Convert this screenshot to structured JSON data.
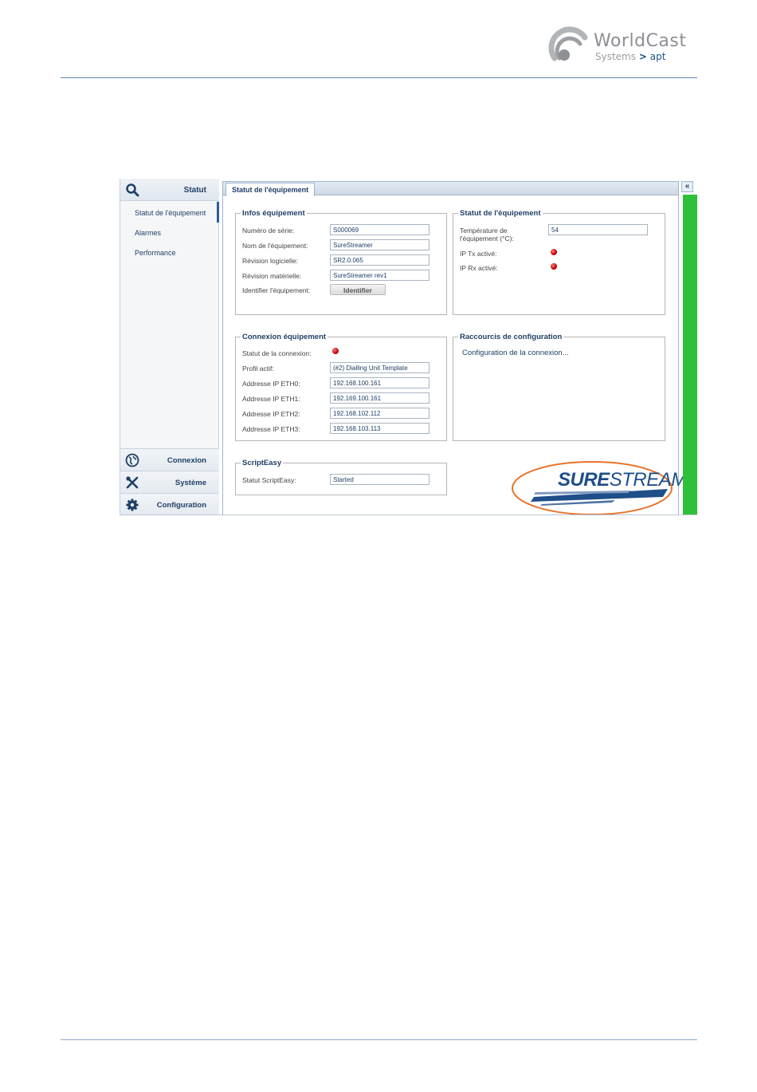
{
  "header": {
    "brand_name": "WorldCast",
    "brand_sub": "Systems",
    "brand_arrow": ">",
    "brand_apt": "apt"
  },
  "sidebar": {
    "top_title": "Statut",
    "items": [
      {
        "label": "Statut de l'équipement",
        "active": true
      },
      {
        "label": "Alarmes"
      },
      {
        "label": "Performance"
      }
    ],
    "bottom": [
      {
        "label": "Connexion",
        "icon": "globe-icon"
      },
      {
        "label": "Système",
        "icon": "tools-icon"
      },
      {
        "label": "Configuration",
        "icon": "gear-icon"
      }
    ]
  },
  "tabs": [
    {
      "label": "Statut de l'équipement"
    }
  ],
  "collapse_label": "«",
  "infos": {
    "legend": "Infos équipement",
    "serial_label": "Numéro de série:",
    "serial_value": "S000069",
    "name_label": "Nom de l'équipement:",
    "name_value": "SureStreamer",
    "sw_label": "Révision logicielle:",
    "sw_value": "SR2.0.065",
    "hw_label": "Révision matérielle:",
    "hw_value": "SureStreamer rev1",
    "identify_label": "Identifier l'équipement:",
    "identify_button": "Identifier"
  },
  "statut": {
    "legend": "Statut de l'équipement",
    "temp_label": "Température de l'équipement (°C):",
    "temp_value": "54",
    "tx_label": "IP Tx activé:",
    "rx_label": "IP Rx activé:"
  },
  "connexion": {
    "legend": "Connexion équipement",
    "status_label": "Statut de la connexion:",
    "profile_label": "Profil actif:",
    "profile_value": "(#2) Dialling Unit Template",
    "eth0_label": "Addresse IP ETH0:",
    "eth0_value": "192.168.100.161",
    "eth1_label": "Addresse IP ETH1:",
    "eth1_value": "192.169.100.161",
    "eth2_label": "Addresse IP ETH2:",
    "eth2_value": "192.168.102.112",
    "eth3_label": "Addresse IP ETH3:",
    "eth3_value": "192.168.103.113"
  },
  "raccourcis": {
    "legend": "Raccourcis de configuration",
    "link": "Configuration de la connexion..."
  },
  "scripteasy": {
    "legend": "ScriptEasy",
    "status_label": "Statut ScriptEasy:",
    "status_value": "Started"
  },
  "surestream": {
    "bold": "SURE",
    "light": "STREAM"
  },
  "colors": {
    "accent": "#1f3f66",
    "status_led": "#c40000",
    "side_bar": "#2fc03a",
    "highlight_ring": "#e8742a"
  }
}
